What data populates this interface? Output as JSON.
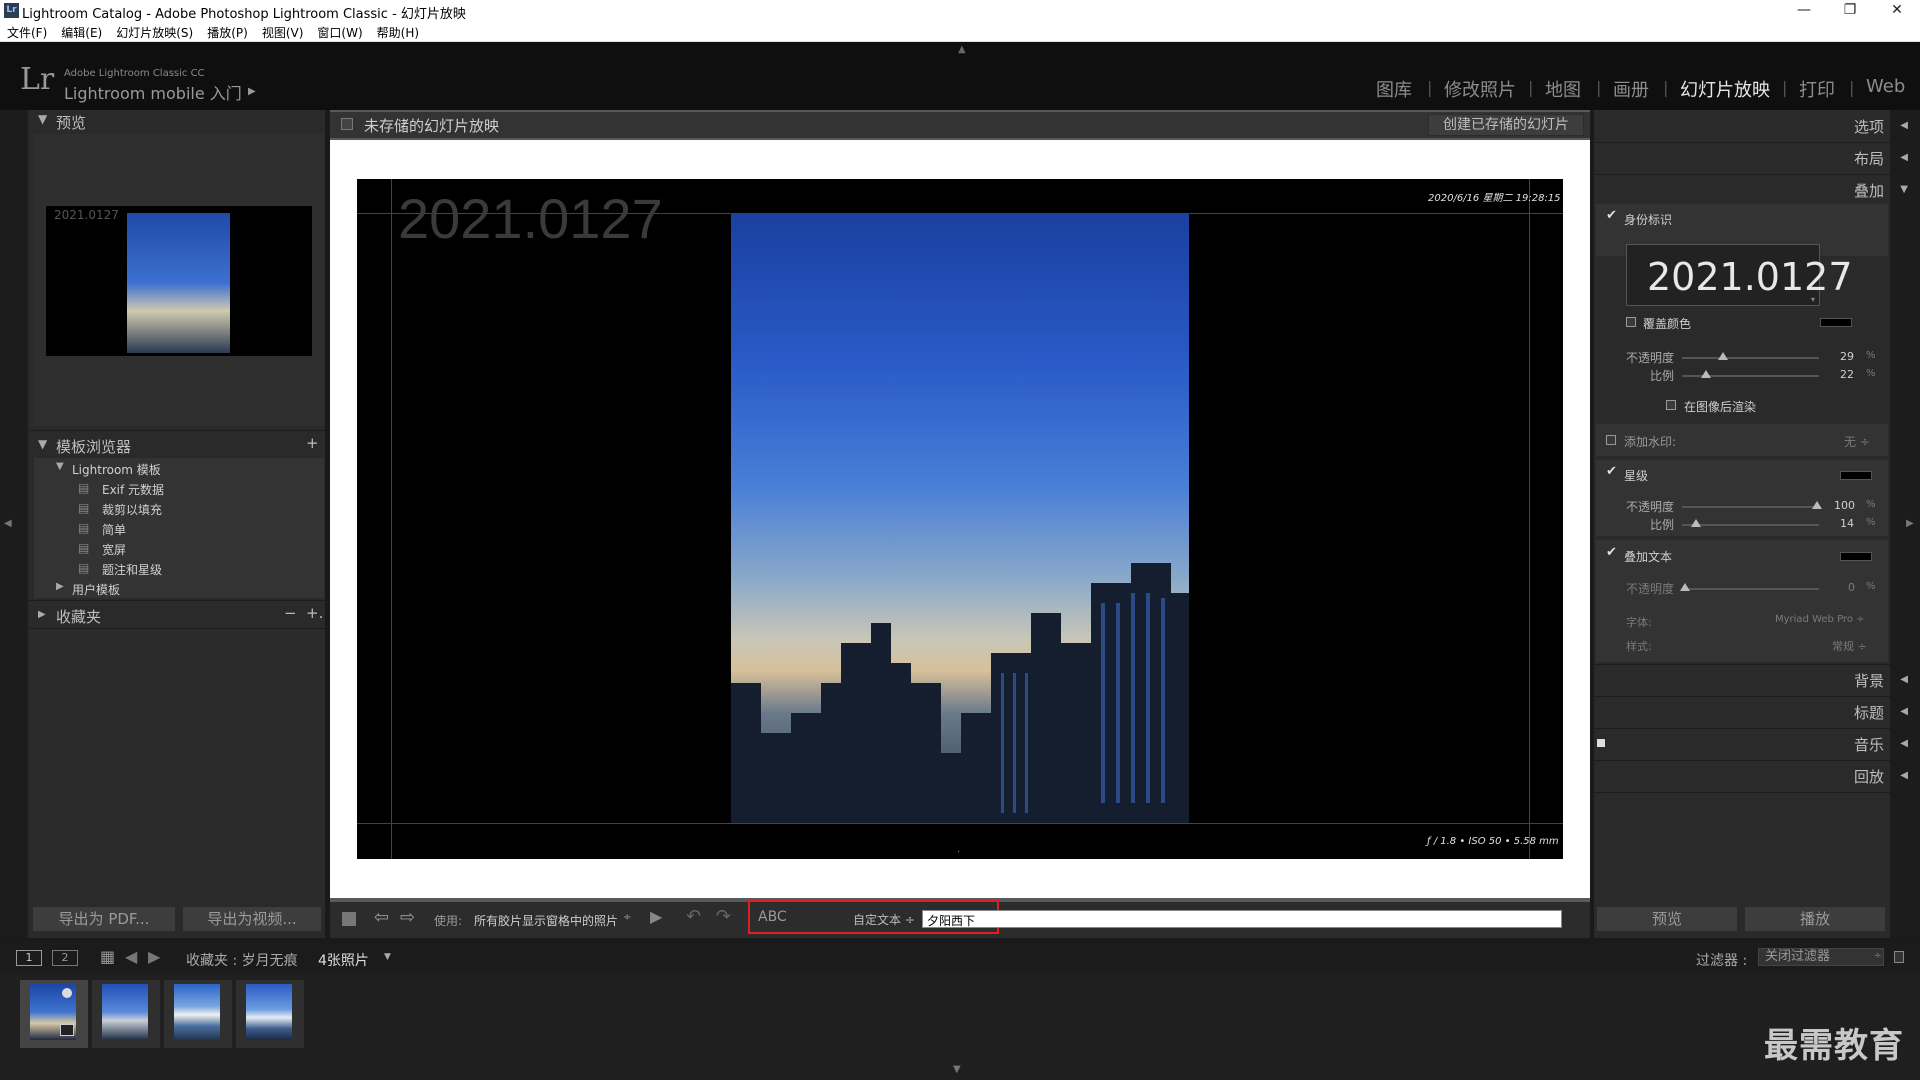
{
  "window": {
    "title": "Lightroom Catalog - Adobe Photoshop Lightroom Classic - 幻灯片放映",
    "icon_label": "Lr",
    "controls": [
      "minimize-icon",
      "restore-icon",
      "close-icon"
    ]
  },
  "menu": [
    "文件(F)",
    "编辑(E)",
    "幻灯片放映(S)",
    "播放(P)",
    "视图(V)",
    "窗口(W)",
    "帮助(H)"
  ],
  "identity": {
    "logo": "Lr",
    "small_text": "Adobe Lightroom Classic CC",
    "main_text": "Lightroom mobile 入门",
    "arrow": "▶"
  },
  "modules": [
    "图库",
    "修改照片",
    "地图",
    "画册",
    "幻灯片放映",
    "打印",
    "Web"
  ],
  "active_module": "幻灯片放映",
  "left": {
    "preview_header": "预览",
    "preview_label": "2021.0127",
    "template_header": "模板浏览器",
    "template_add": "+",
    "template_folder": "Lightroom 模板",
    "templates": [
      "Exif 元数据",
      "裁剪以填充",
      "简单",
      "宽屏",
      "题注和星级"
    ],
    "user_templates": "用户模板",
    "collections_header": "收藏夹",
    "collections_minus": "−",
    "collections_plus": "+.",
    "export_pdf": "导出为 PDF...",
    "export_video": "导出为视频..."
  },
  "center": {
    "header_title": "未存储的幻灯片放映",
    "create_saved": "创建已存储的幻灯片",
    "identity_plate_text": "2021.0127",
    "date_overlay": "2020/6/16 星期二 19:28:15",
    "exif_overlay": "ƒ / 1.8 • ISO 50 • 5.58 mm",
    "dot": "."
  },
  "toolbar": {
    "use_label": "使用:",
    "use_value": "所有胶片显示窗格中的照片",
    "abc": "ABC",
    "custom_text_label": "自定文本 ÷",
    "custom_text_value": "夕阳西下"
  },
  "right": {
    "options": "选项",
    "layout": "布局",
    "overlays": "叠加",
    "identity_plate": "身份标识",
    "plate_text": "2021.0127",
    "override_color": "覆盖颜色",
    "opacity_label": "不透明度",
    "opacity_value": "29",
    "scale_label": "比例",
    "scale_value": "22",
    "percent": "%",
    "render_behind": "在图像后渲染",
    "watermark": "添加水印:",
    "watermark_value": "无 ÷",
    "rating": "星级",
    "rating_opacity_value": "100",
    "rating_scale_value": "14",
    "text_overlay": "叠加文本",
    "text_opacity_value": "0",
    "font_label": "字体:",
    "font_value": "Myriad Web Pro ÷",
    "style_label": "样式:",
    "style_value": "常规 ÷",
    "backdrop": "背景",
    "titles": "标题",
    "music": "音乐",
    "playback": "回放",
    "preview_btn": "预览",
    "play_btn": "播放",
    "opacity_level": 0.29,
    "scale_level": 0.22,
    "rating_opacity_level": 1.0,
    "rating_scale_level": 0.14,
    "text_opacity_level": 0.0
  },
  "filmbar": {
    "view1": "1",
    "view2": "2",
    "source": "收藏夹 : 岁月无痕",
    "count": "4张照片",
    "filter_label": "过滤器 :",
    "filter_value": "关闭过滤器"
  },
  "thumbnails": 4,
  "watermark_text": "最需教育",
  "colors": {
    "accent_red": "#e02020",
    "panel_bg": "#2a2a2a",
    "center_bg": "#595959"
  }
}
